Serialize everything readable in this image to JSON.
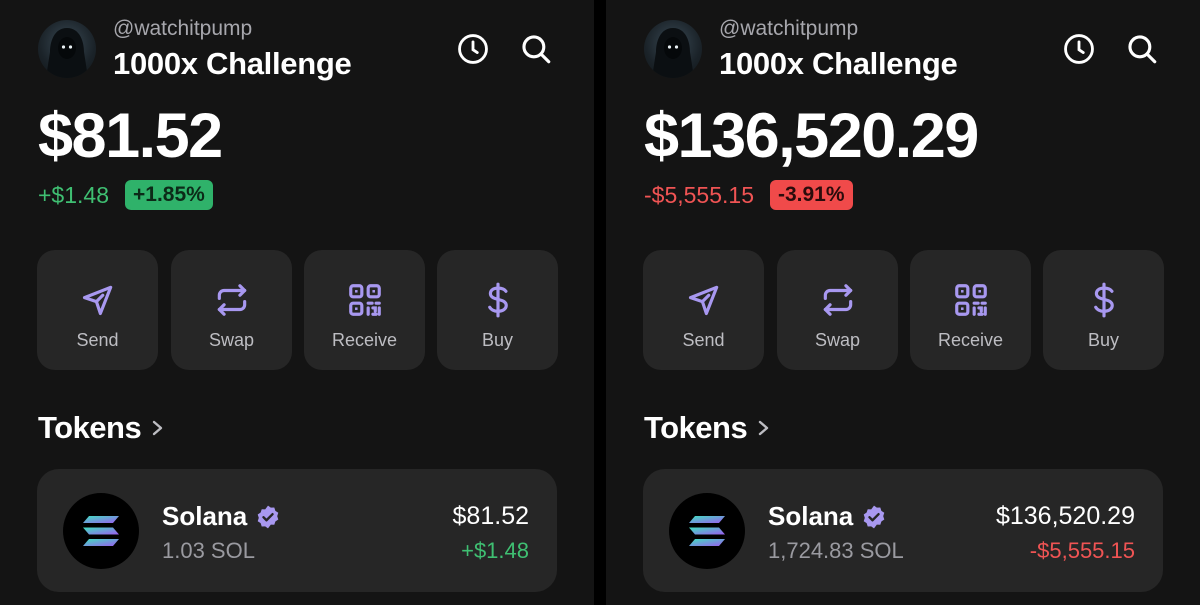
{
  "colors": {
    "accent": "#a898f0",
    "positive": "#2fb26a",
    "negative": "#f04a4a",
    "background": "#141414",
    "card": "#262626"
  },
  "icons": {
    "history": "clock-icon",
    "search": "search-icon",
    "send": "send-icon",
    "swap": "swap-icon",
    "receive": "qr-code-icon",
    "buy": "dollar-icon",
    "verified": "verified-badge-icon",
    "token_logo": "solana-logo-icon",
    "tokens_chevron": "chevron-right-icon"
  },
  "panels": [
    {
      "header": {
        "username": "@watchitpump",
        "wallet_name": "1000x Challenge"
      },
      "balance": "$81.52",
      "change": {
        "amount": "+$1.48",
        "percent": "+1.85%",
        "direction": "positive"
      },
      "actions": [
        {
          "label": "Send"
        },
        {
          "label": "Swap"
        },
        {
          "label": "Receive"
        },
        {
          "label": "Buy"
        }
      ],
      "tokens_title": "Tokens",
      "token": {
        "name": "Solana",
        "quantity": "1.03 SOL",
        "value": "$81.52",
        "change": "+$1.48"
      }
    },
    {
      "header": {
        "username": "@watchitpump",
        "wallet_name": "1000x Challenge"
      },
      "balance": "$136,520.29",
      "change": {
        "amount": "-$5,555.15",
        "percent": "-3.91%",
        "direction": "negative"
      },
      "actions": [
        {
          "label": "Send"
        },
        {
          "label": "Swap"
        },
        {
          "label": "Receive"
        },
        {
          "label": "Buy"
        }
      ],
      "tokens_title": "Tokens",
      "token": {
        "name": "Solana",
        "quantity": "1,724.83 SOL",
        "value": "$136,520.29",
        "change": "-$5,555.15"
      }
    }
  ]
}
